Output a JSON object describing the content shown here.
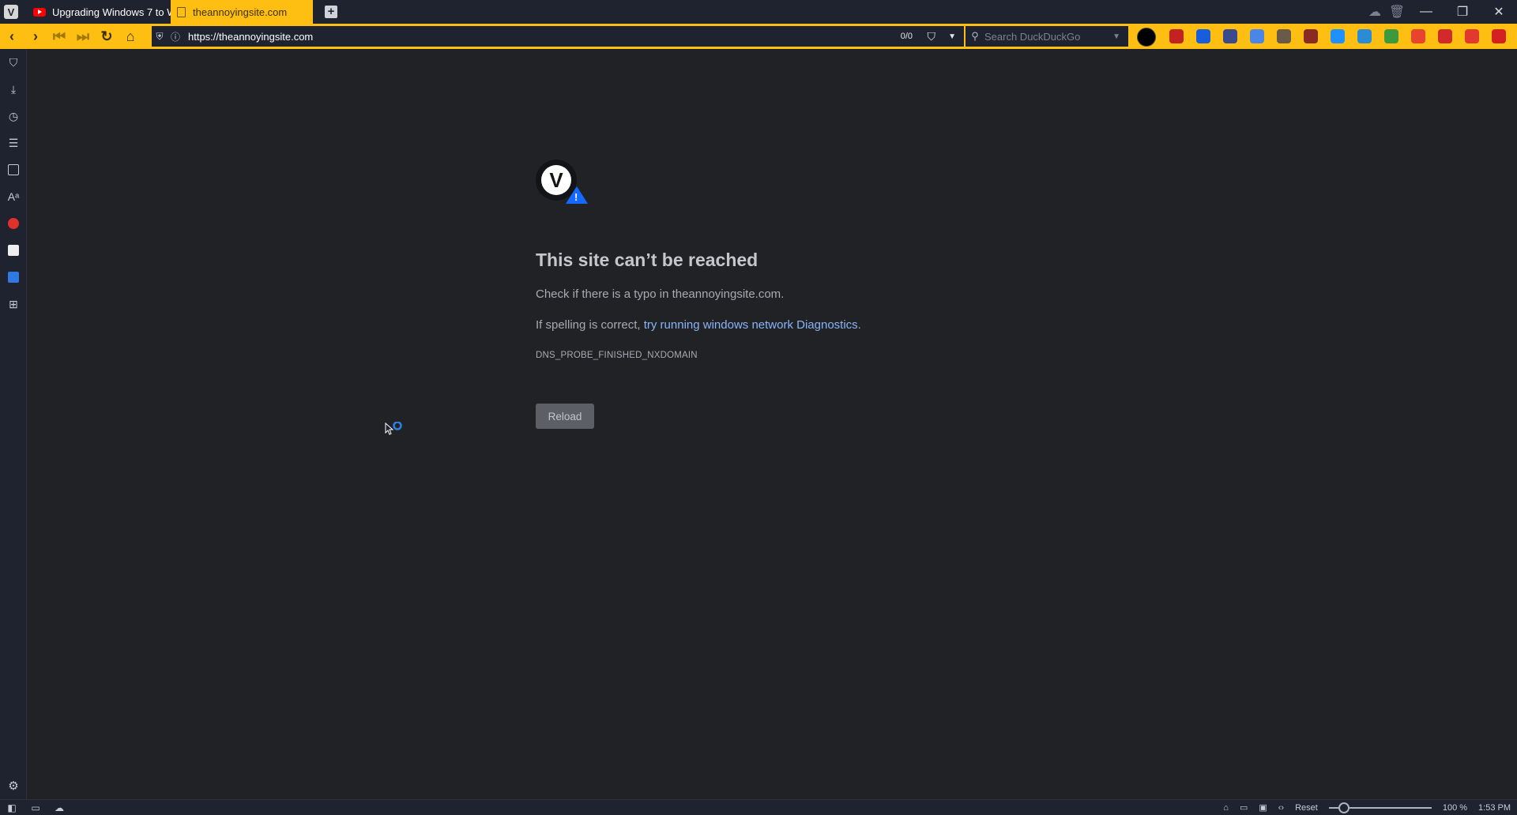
{
  "tabs": [
    {
      "title": "Upgrading Windows 7 to W",
      "icon": "youtube-icon",
      "active": false
    },
    {
      "title": "theannoyingsite.com",
      "icon": "document-icon",
      "active": true
    }
  ],
  "address_bar": {
    "url": "https://theannoyingsite.com",
    "block_counter": "0/0",
    "search_placeholder": "Search DuckDuckGo"
  },
  "extensions": [
    "ublock-icon",
    "bitwarden-icon",
    "extension-icon",
    "translate-icon",
    "extension-icon",
    "extension-icon",
    "skype-icon",
    "extension-icon",
    "extension-icon",
    "extension-icon",
    "extension-icon",
    "extension-icon",
    "extension-icon"
  ],
  "side_panel": {
    "items": [
      "bookmarks-icon",
      "downloads-icon",
      "history-icon",
      "notes-icon",
      "window-icon",
      "translate-panel-icon",
      "vivaldi-icon",
      "wikipedia-icon",
      "translate-icon",
      "add-panel-icon"
    ],
    "settings_icon": "gear-icon"
  },
  "error_page": {
    "title": "This site can’t be reached",
    "line1": "Check if there is a typo in theannoyingsite.com.",
    "line2_prefix": "If spelling is correct, ",
    "line2_link": "try running windows network Diagnostics",
    "line2_suffix": ".",
    "error_code": "DNS_PROBE_FINISHED_NXDOMAIN",
    "reload_label": "Reload"
  },
  "status_bar": {
    "reset_label": "Reset",
    "zoom_level": "100 %",
    "zoom_fraction": 0.15,
    "time": "1:53 PM"
  },
  "colors": {
    "accent": "#ffbe12",
    "chrome": "#1f2330",
    "content_bg": "#202226",
    "link": "#8ab4f8"
  }
}
